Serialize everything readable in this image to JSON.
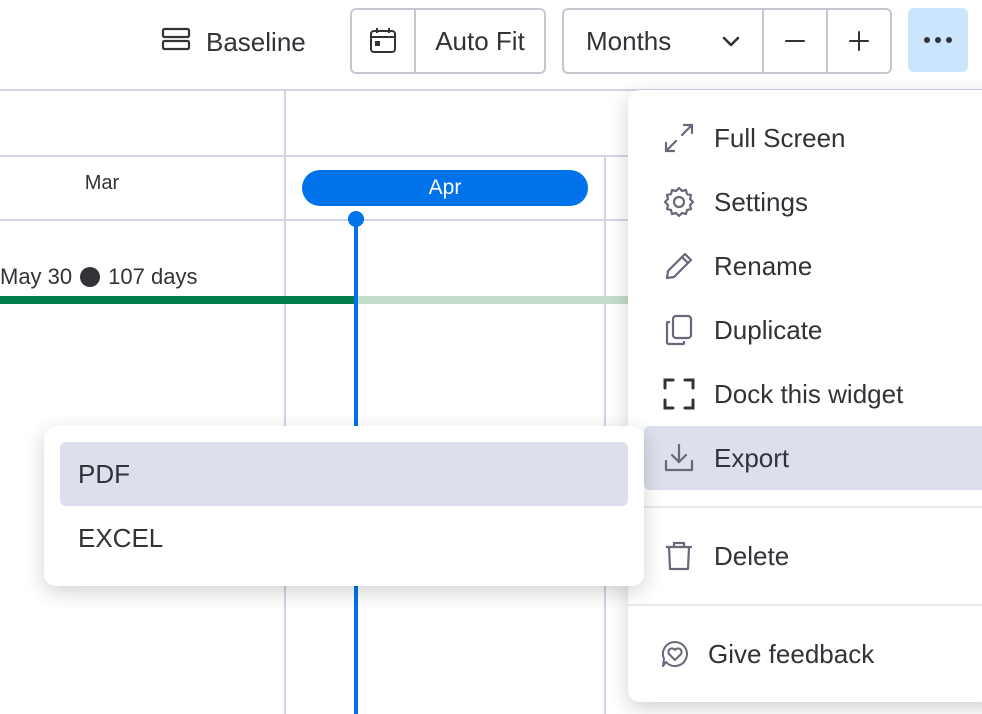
{
  "toolbar": {
    "baseline_label": "Baseline",
    "autofit_label": "Auto Fit",
    "months_label": "Months",
    "zoom_out_symbol": "−",
    "zoom_in_symbol": "+",
    "more_icon": "ellipsis-icon"
  },
  "timeline": {
    "months": [
      "Mar",
      "Apr"
    ],
    "current_month": "Apr",
    "item": {
      "end_date_label": "May 30",
      "duration_label": "107 days",
      "color_done": "#037f4c",
      "color_remaining": "#c4dcca"
    },
    "today_color": "#0073ea"
  },
  "menu": {
    "items": [
      {
        "label": "Full Screen",
        "icon": "expand-icon"
      },
      {
        "label": "Settings",
        "icon": "gear-icon"
      },
      {
        "label": "Rename",
        "icon": "pencil-icon"
      },
      {
        "label": "Duplicate",
        "icon": "duplicate-icon"
      },
      {
        "label": "Dock this widget",
        "icon": "dock-icon"
      },
      {
        "label": "Export",
        "icon": "download-icon",
        "active": true
      },
      {
        "label": "Delete",
        "icon": "trash-icon"
      },
      {
        "label": "Give feedback",
        "icon": "feedback-icon"
      }
    ]
  },
  "export_submenu": {
    "items": [
      {
        "label": "PDF",
        "active": true
      },
      {
        "label": "EXCEL"
      }
    ]
  },
  "colors": {
    "accent": "#0073ea",
    "active_bg": "#dcdfec",
    "more_button_bg": "#cce5ff"
  }
}
